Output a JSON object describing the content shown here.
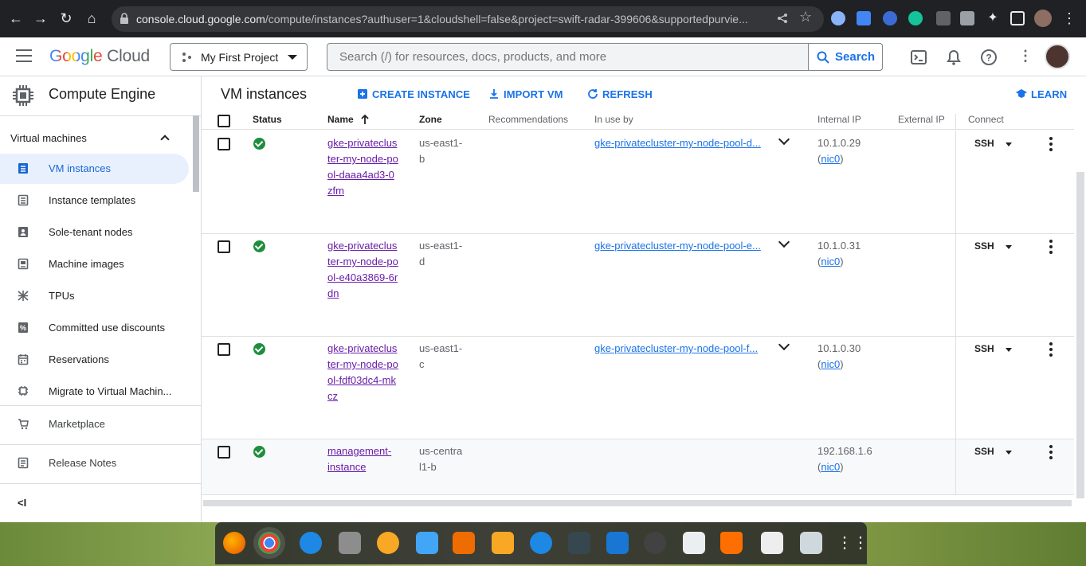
{
  "browser": {
    "url_host": "console.cloud.google.com",
    "url_rest": "/compute/instances?authuser=1&cloudshell=false&project=swift-radar-399606&supportedpurvie..."
  },
  "header": {
    "logo_google": "Google",
    "logo_cloud": "Cloud",
    "project": "My First Project",
    "search_placeholder": "Search (/) for resources, docs, products, and more",
    "search_button": "Search"
  },
  "sidebar": {
    "product": "Compute Engine",
    "section": "Virtual machines",
    "items": [
      {
        "label": "VM instances",
        "icon": "vm-icon"
      },
      {
        "label": "Instance templates",
        "icon": "template-icon"
      },
      {
        "label": "Sole-tenant nodes",
        "icon": "node-icon"
      },
      {
        "label": "Machine images",
        "icon": "image-icon"
      },
      {
        "label": "TPUs",
        "icon": "tpu-icon"
      },
      {
        "label": "Committed use discounts",
        "icon": "discount-icon"
      },
      {
        "label": "Reservations",
        "icon": "calendar-icon"
      },
      {
        "label": "Migrate to Virtual Machin...",
        "icon": "migrate-icon"
      }
    ],
    "marketplace": "Marketplace",
    "release_notes": "Release Notes",
    "collapse": "<I"
  },
  "toolbar": {
    "title": "VM instances",
    "create": "CREATE INSTANCE",
    "import": "IMPORT VM",
    "refresh": "REFRESH",
    "learn": "LEARN"
  },
  "table": {
    "columns": [
      "Status",
      "Name",
      "Zone",
      "Recommendations",
      "In use by",
      "Internal IP",
      "External IP",
      "Connect"
    ],
    "rows": [
      {
        "name": "gke-privatecluster-my-node-pool-daaa4ad3-0zfm",
        "zone": "us-east1-b",
        "in_use_by": "gke-privatecluster-my-node-pool-d...",
        "ip": "10.1.0.29",
        "nic": "nic0",
        "connect": "SSH"
      },
      {
        "name": "gke-privatecluster-my-node-pool-e40a3869-6rdn",
        "zone": "us-east1-d",
        "in_use_by": "gke-privatecluster-my-node-pool-e...",
        "ip": "10.1.0.31",
        "nic": "nic0",
        "connect": "SSH"
      },
      {
        "name": "gke-privatecluster-my-node-pool-fdf03dc4-mkcz",
        "zone": "us-east1-c",
        "in_use_by": "gke-privatecluster-my-node-pool-f...",
        "ip": "10.1.0.30",
        "nic": "nic0",
        "connect": "SSH"
      },
      {
        "name": "management-instance",
        "zone": "us-central1-b",
        "in_use_by": "",
        "ip": "192.168.1.6",
        "nic": "nic0",
        "connect": "SSH"
      }
    ]
  },
  "colors": {
    "accent": "#1a73e8",
    "visited_link": "#681da8",
    "status_ok": "#1e8e3e",
    "active_nav_bg": "#e8f0fe"
  }
}
